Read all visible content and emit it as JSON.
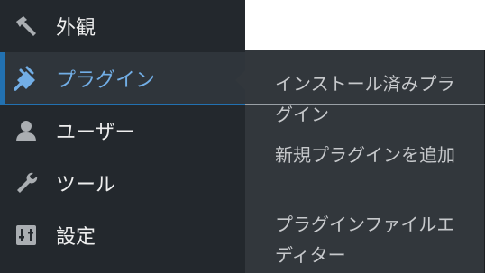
{
  "sidebar": {
    "items": [
      {
        "label": "外観",
        "icon": "paintbrush-icon"
      },
      {
        "label": "プラグイン",
        "icon": "plugin-icon",
        "current": true
      },
      {
        "label": "ユーザー",
        "icon": "user-icon"
      },
      {
        "label": "ツール",
        "icon": "wrench-icon"
      },
      {
        "label": "設定",
        "icon": "settings-icon"
      }
    ]
  },
  "submenu": {
    "items": [
      {
        "label": "インストール済みプラグイン"
      },
      {
        "label": "新規プラグインを追加"
      },
      {
        "label": "プラグインファイルエディター"
      }
    ]
  },
  "colors": {
    "sidebar_bg": "#23282d",
    "submenu_bg": "#32373c",
    "accent": "#2271b1",
    "current_text": "#72aee6"
  }
}
